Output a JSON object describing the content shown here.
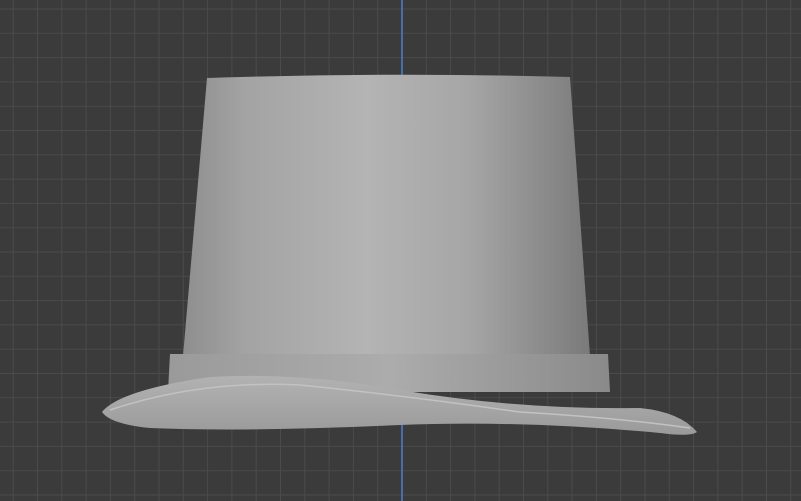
{
  "viewport": {
    "background_color": "#3b3b3b",
    "grid_color": "#4b4b4b",
    "axis_color": "#4a7fd0",
    "model_color": "#a8a8a8",
    "object": "top-hat-mesh"
  }
}
